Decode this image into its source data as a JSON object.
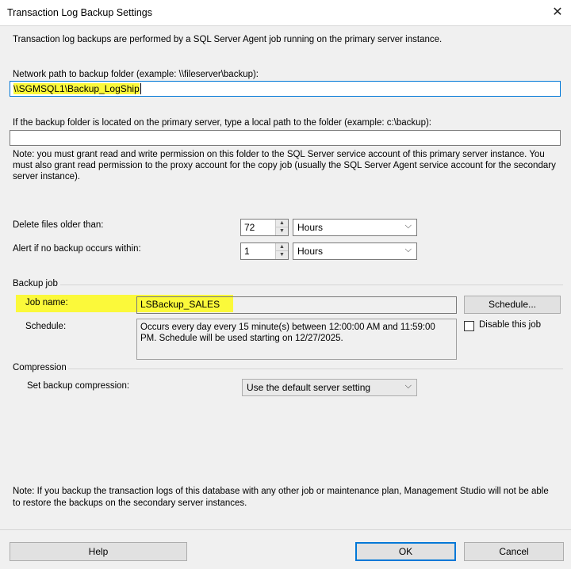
{
  "window": {
    "title": "Transaction Log Backup Settings",
    "close_glyph": "✕"
  },
  "intro": "Transaction log backups are performed by a SQL Server Agent job running on the primary server instance.",
  "network_path": {
    "label": "Network path to backup folder (example: \\\\fileserver\\backup):",
    "value": "\\\\SGMSQL1\\Backup_LogShip"
  },
  "local_path": {
    "label": "If the backup folder is located on the primary server, type a local path to the folder (example: c:\\backup):",
    "value": ""
  },
  "permission_note": "Note: you must grant read and write permission on this folder to the SQL Server service account of this primary server instance.  You must also grant read permission to the proxy account for the copy job (usually the SQL Server Agent service account for the secondary server instance).",
  "delete_files": {
    "label": "Delete files older than:",
    "value": "72",
    "unit": "Hours"
  },
  "alert": {
    "label": "Alert if no backup occurs within:",
    "value": "1",
    "unit": "Hours"
  },
  "backup_job": {
    "group_label": "Backup job",
    "job_name_label": "Job name:",
    "job_name_value": "LSBackup_SALES",
    "schedule_button": "Schedule...",
    "schedule_label": "Schedule:",
    "schedule_text": "Occurs every day every 15 minute(s) between 12:00:00 AM and 11:59:00 PM. Schedule will be used starting on 12/27/2025.",
    "disable_label": "Disable this job"
  },
  "compression": {
    "group_label": "Compression",
    "label": "Set backup compression:",
    "value": "Use the default server setting"
  },
  "footer_note": "Note: If you backup the transaction logs of this database with any other job or maintenance plan, Management Studio will not be able to restore the backups on the secondary server instances.",
  "buttons": {
    "help": "Help",
    "ok": "OK",
    "cancel": "Cancel"
  },
  "icons": {
    "spin_up": "▲",
    "spin_down": "▼",
    "chevron": "⌵"
  },
  "colors": {
    "highlight": "#fbf93a",
    "focus": "#0078d7",
    "background": "#f0f0f0"
  }
}
